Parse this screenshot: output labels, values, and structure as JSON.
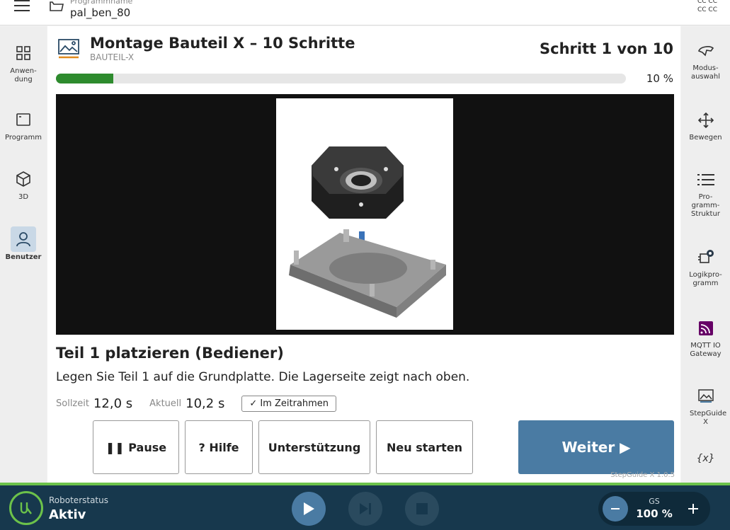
{
  "header": {
    "program_label": "Programmname",
    "program_name": "pal_ben_80",
    "top_right_line1": "CC CC",
    "top_right_line2": "CC CC"
  },
  "left_nav": [
    {
      "label": "Anwen-dung",
      "icon": "grid-icon"
    },
    {
      "label": "Programm",
      "icon": "program-icon"
    },
    {
      "label": "3D",
      "icon": "cube-icon"
    },
    {
      "label": "Benutzer",
      "icon": "user-icon",
      "active": true
    }
  ],
  "right_nav": [
    {
      "label": "Modus-auswahl",
      "icon": "mode-icon"
    },
    {
      "label": "Bewegen",
      "icon": "move-icon"
    },
    {
      "label": "Pro-gramm-Struktur",
      "icon": "list-icon"
    },
    {
      "label": "Logikpro-gramm",
      "icon": "logic-icon"
    },
    {
      "label": "MQTT IO Gateway",
      "icon": "mqtt-icon"
    },
    {
      "label": "StepGuide X",
      "icon": "image-icon"
    },
    {
      "label": "",
      "icon": "variables-icon",
      "glyph": "{x}"
    }
  ],
  "main": {
    "title": "Montage Bauteil X – 10 Schritte",
    "subtitle": "BAUTEIL-X",
    "step_counter": "Schritt 1 von 10",
    "progress_fraction": 0.1,
    "progress_text": "10 %",
    "step_title": "Teil 1 platzieren (Bediener)",
    "step_description": "Legen Sie Teil 1 auf die Grundplatte. Die Lagerseite zeigt nach oben.",
    "target_label": "Sollzeit",
    "target_value": "12,0 s",
    "actual_label": "Aktuell",
    "actual_value": "10,2 s",
    "status_badge": "✓  Im Zeitrahmen",
    "buttons": {
      "pause": "❚❚ Pause",
      "help": "? Hilfe",
      "support": "Unterstützung",
      "restart": "Neu starten",
      "next": "Weiter ▶"
    },
    "version": "StepGuide X 1.0.5"
  },
  "bottom": {
    "robot_status_label": "Roboterstatus",
    "robot_status_value": "Aktiv",
    "speed_label": "GS",
    "speed_value": "100 %"
  },
  "colors": {
    "accent": "#4a7ba3",
    "progress_green": "#2e8b2e",
    "bottom_bar": "#17384d",
    "status_green": "#6cc24a"
  }
}
